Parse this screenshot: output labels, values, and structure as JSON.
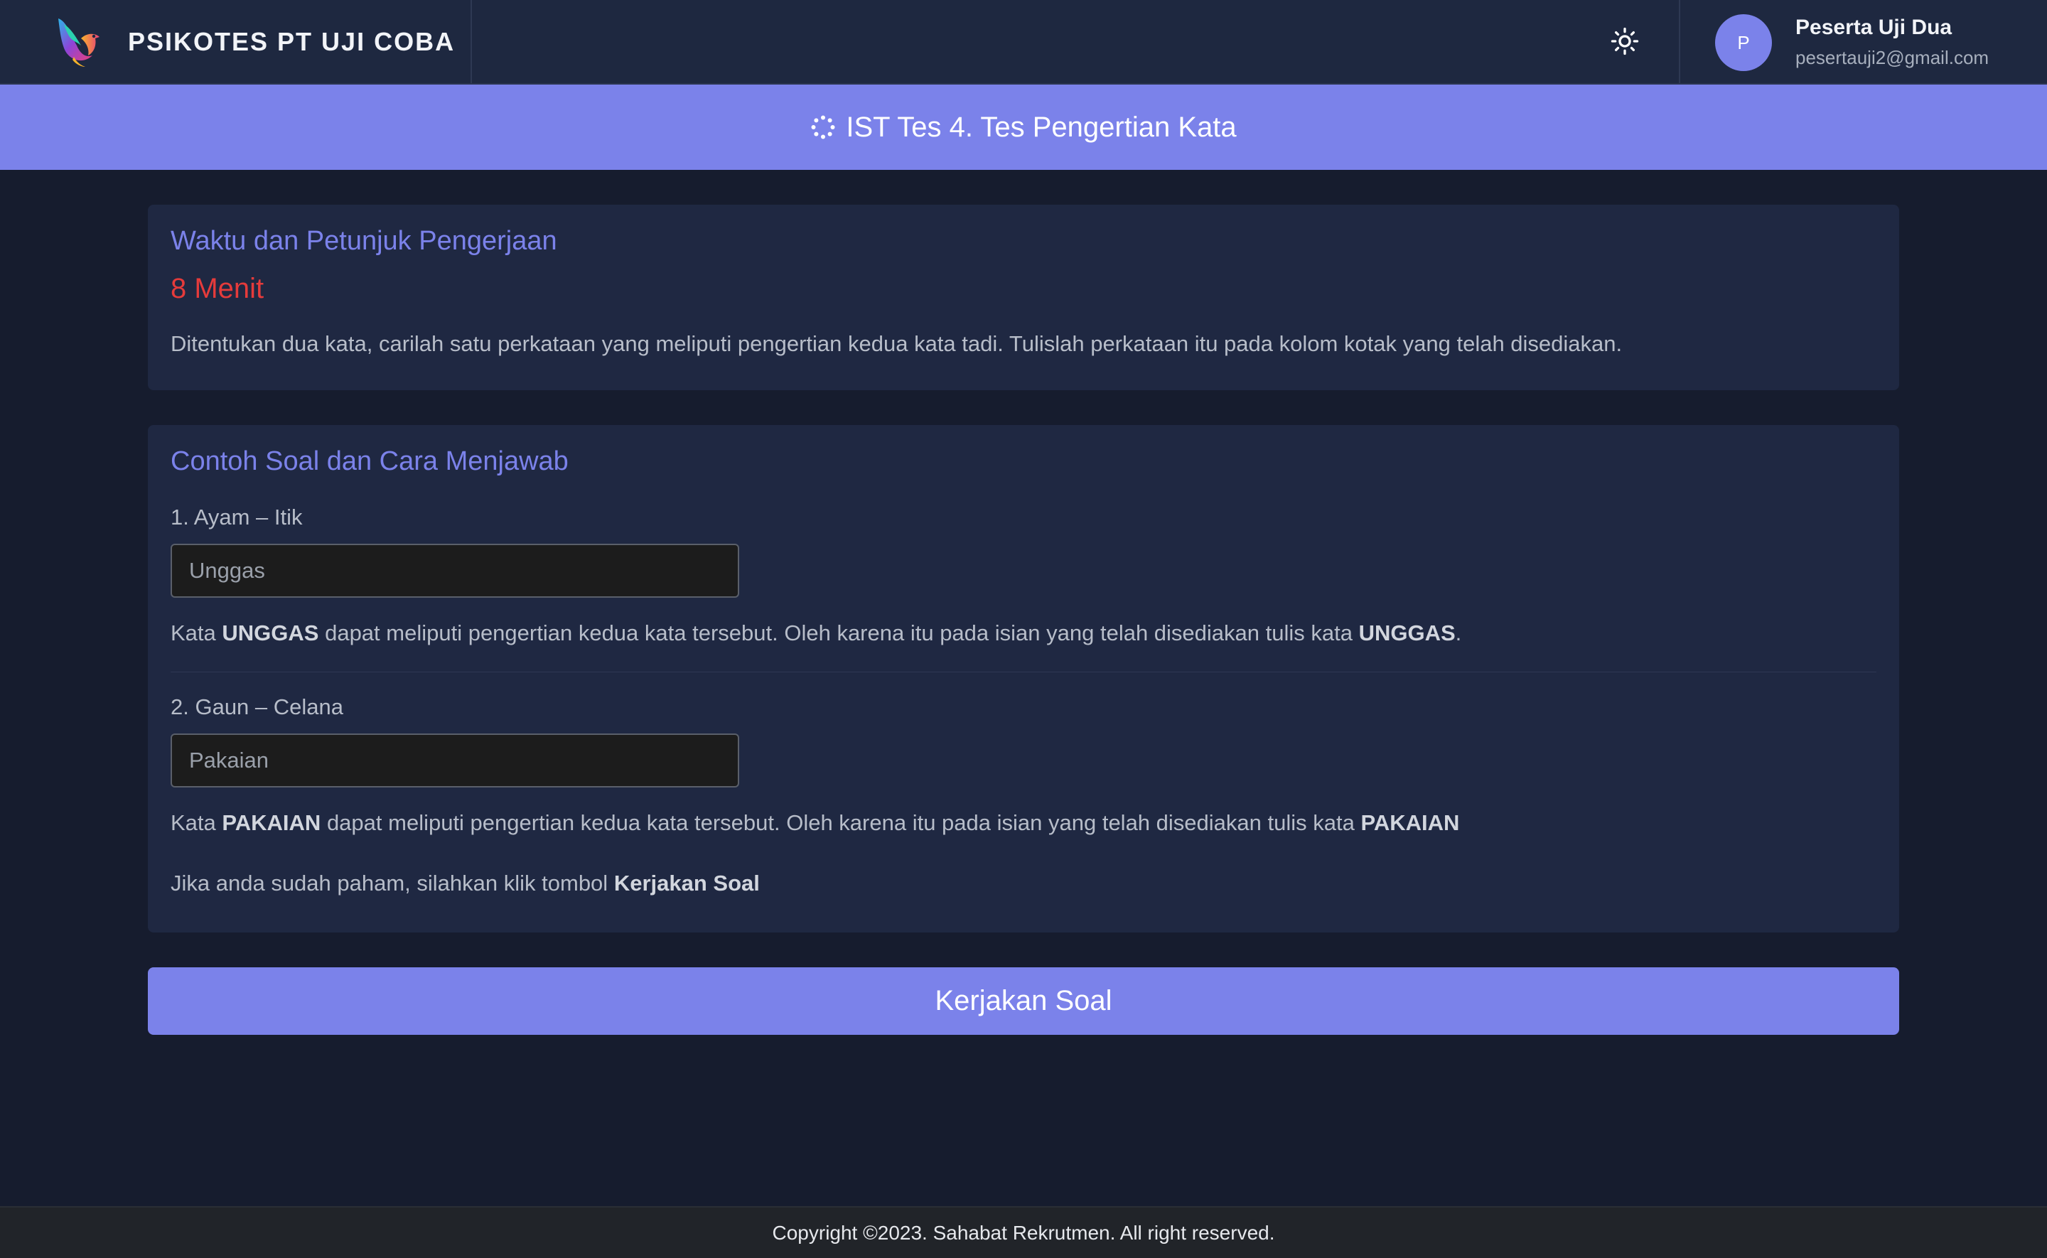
{
  "header": {
    "brand_name": "PSIKOTES PT UJI COBA",
    "logo_icon": "bird-logo-icon",
    "theme_icon": "sun-icon",
    "user": {
      "initial": "P",
      "name": "Peserta Uji Dua",
      "email": "pesertauji2@gmail.com"
    }
  },
  "banner": {
    "icon": "spinner-icon",
    "title": "IST Tes 4. Tes Pengertian Kata"
  },
  "instructions": {
    "title": "Waktu dan Petunjuk Pengerjaan",
    "duration": "8 Menit",
    "text": "Ditentukan dua kata, carilah satu perkataan yang meliputi pengertian kedua kata tadi. Tulislah perkataan itu pada kolom kotak yang telah disediakan."
  },
  "examples": {
    "title": "Contoh Soal dan Cara Menjawab",
    "items": [
      {
        "question": "1. Ayam – Itik",
        "answer": "Unggas",
        "exp_prefix": "Kata ",
        "exp_word": "UNGGAS",
        "exp_middle": " dapat meliputi pengertian kedua kata tersebut. Oleh karena itu pada isian yang telah disediakan tulis kata ",
        "exp_word2": "UNGGAS",
        "exp_suffix": "."
      },
      {
        "question": "2. Gaun – Celana",
        "answer": "Pakaian",
        "exp_prefix": "Kata ",
        "exp_word": "PAKAIAN",
        "exp_middle": " dapat meliputi pengertian kedua kata tersebut. Oleh karena itu pada isian yang telah disediakan tulis kata ",
        "exp_word2": "PAKAIAN",
        "exp_suffix": ""
      }
    ],
    "closing_prefix": "Jika anda sudah paham, silahkan klik tombol ",
    "closing_bold": "Kerjakan Soal"
  },
  "start_button": "Kerjakan Soal",
  "footer": "Copyright ©2023. Sahabat Rekrutmen. All right reserved.",
  "colors": {
    "accent": "#7b82ea",
    "background": "#161c2e",
    "card": "#1f2842",
    "header": "#1e2840",
    "danger": "#e53b3b"
  }
}
